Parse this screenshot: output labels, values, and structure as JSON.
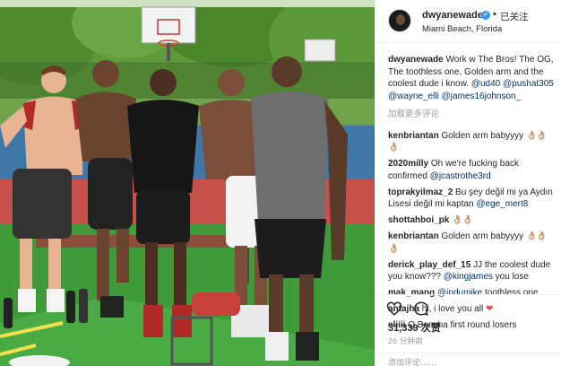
{
  "post": {
    "username": "dwyanewade",
    "follow_dot": "•",
    "follow_label": "已关注",
    "location": "Miami Beach, Florida"
  },
  "caption": {
    "username": "dwyanewade",
    "text": "Work w The Bros! The OG, The toothless one, Golden arm and the coolest dude i know.",
    "mentions": [
      "@ud40",
      "@pushat305",
      "@wayne_elli",
      "@james16johnson_"
    ]
  },
  "load_more_label": "加载更多评论",
  "comments": [
    {
      "username": "kenbriantan",
      "text": "Golden arm babyyyy",
      "emoji": "👌🏼👌🏼👌🏼"
    },
    {
      "username": "2020milly",
      "text": "Oh we're fucking back confirmed",
      "mention": "@jcastrothe3rd"
    },
    {
      "username": "toprakyilmaz_2",
      "text": "Bu şey değil mi ya Aydın Lisesi değil mi kaptan",
      "mention": "@ege_mert8"
    },
    {
      "username": "shottahboi_pk",
      "text": "",
      "emoji": "👌🏼👌🏼"
    },
    {
      "username": "kenbriantan",
      "text": "Golden arm babyyyy",
      "emoji": "👌🏼👌🏼👌🏼"
    },
    {
      "username": "derick_play_def_15",
      "text": "JJ the coolest dude you know???",
      "mention": "@kingjames",
      "text_after": "you lose"
    },
    {
      "username": "mak_mang",
      "text": "",
      "mention": "@indumike",
      "text_after": "toothless one"
    },
    {
      "username": "antajha",
      "text": "hi, i love you all",
      "heart": "❤"
    },
    {
      "username": "eliiii",
      "text": "Q Buncha first round losers"
    }
  ],
  "likes": "31,339 次赞",
  "time": "26 分钟前",
  "add_comment_placeholder": "添加评论……",
  "icons": [
    "heart-icon",
    "comment-icon",
    "verified-badge-icon"
  ],
  "colors": {
    "link": "#003569",
    "verified": "#3897f0",
    "muted": "#999999",
    "like": "#ed4956"
  }
}
